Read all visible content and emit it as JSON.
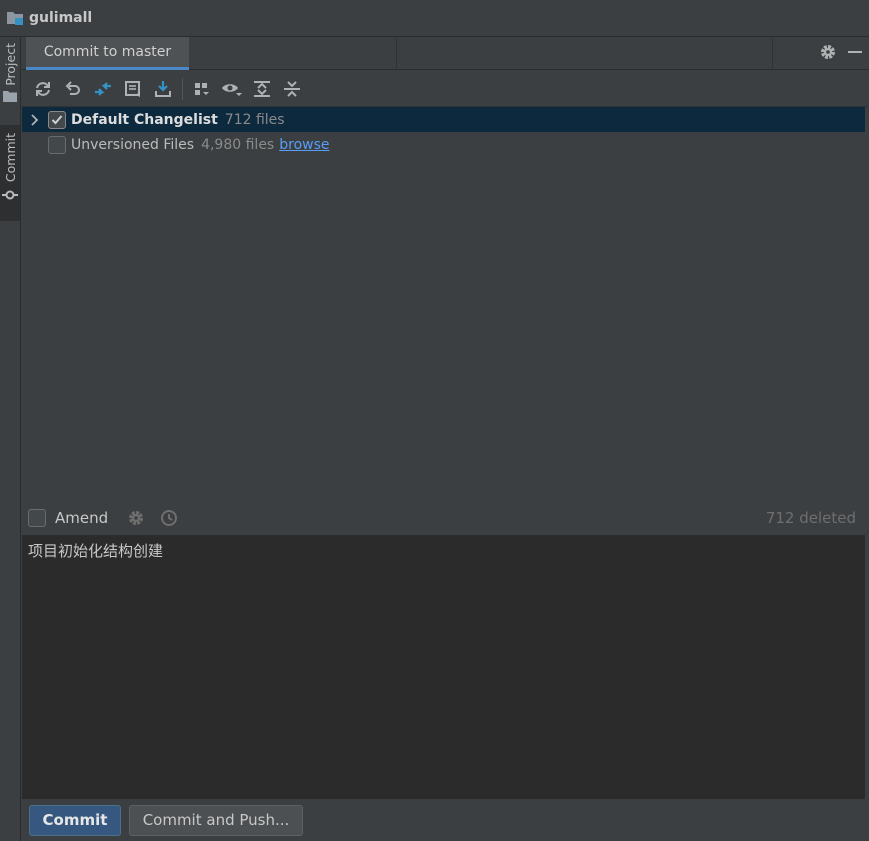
{
  "window": {
    "title": "gulimall"
  },
  "side_tabs": {
    "project": "Project",
    "commit": "Commit"
  },
  "tab": {
    "label": "Commit to master"
  },
  "tree": {
    "default_changelist": {
      "label": "Default Changelist",
      "count": "712 files",
      "checked": true
    },
    "unversioned": {
      "label": "Unversioned Files",
      "count": "4,980 files",
      "link": "browse",
      "checked": false
    }
  },
  "amend": {
    "label": "Amend",
    "status": "712 deleted"
  },
  "message": {
    "text": "项目初始化结构创建"
  },
  "buttons": {
    "commit": "Commit",
    "commit_push": "Commit and Push..."
  },
  "colors": {
    "accent": "#4a88c7",
    "selection": "#0d293e",
    "link": "#589df6",
    "primary_button": "#365880"
  },
  "toolbar_icons": [
    "refresh-icon",
    "rollback-icon",
    "diff-icon",
    "shelve-icon",
    "update-icon",
    "group-by-icon",
    "view-options-icon",
    "expand-all-icon",
    "collapse-all-icon"
  ]
}
